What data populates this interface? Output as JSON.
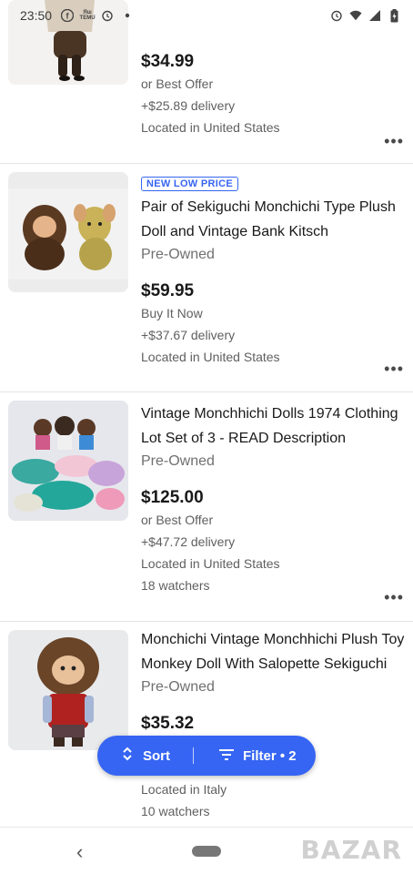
{
  "status_bar": {
    "time": "23:50",
    "left_icons": [
      "facebook-icon",
      "temu-icon",
      "alarm-icon",
      "dot-icon"
    ],
    "temu_text": [
      "Яш",
      "TEMU"
    ],
    "right_icons": [
      "alarm-icon",
      "wifi-icon",
      "signal-icon",
      "battery-icon"
    ]
  },
  "listings": [
    {
      "badge": "",
      "title": "",
      "condition": "",
      "price": "$34.99",
      "buy_format": "or Best Offer",
      "delivery": "+$25.89 delivery",
      "location": "Located in United States",
      "watchers": ""
    },
    {
      "badge": "NEW LOW PRICE",
      "title": "Pair of Sekiguchi Monchichi Type Plush Doll and Vintage Bank Kitsch",
      "condition": "Pre-Owned",
      "price": "$59.95",
      "buy_format": "Buy It Now",
      "delivery": "+$37.67 delivery",
      "location": "Located in United States",
      "watchers": ""
    },
    {
      "badge": "",
      "title": "Vintage Monchhichi Dolls 1974 Clothing Lot Set of 3 - READ Description",
      "condition": "Pre-Owned",
      "price": "$125.00",
      "buy_format": "or Best Offer",
      "delivery": "+$47.72 delivery",
      "location": "Located in United States",
      "watchers": "18 watchers"
    },
    {
      "badge": "",
      "title": "Monchichi Vintage Monchhichi Plush Toy Monkey Doll With Salopette Sekiguchi",
      "condition": "Pre-Owned",
      "price": "$35.32",
      "buy_format": "",
      "delivery": "",
      "location": "Located in Italy",
      "watchers": "10 watchers"
    }
  ],
  "more_options": "•••",
  "fab": {
    "sort_label": "Sort",
    "filter_label": "Filter • 2",
    "accent": "#3665f3"
  },
  "nav": {
    "back": "‹"
  },
  "watermark": "BAZAR",
  "colors": {
    "accent": "#3665f3",
    "text": "#191919",
    "muted": "#707070"
  }
}
